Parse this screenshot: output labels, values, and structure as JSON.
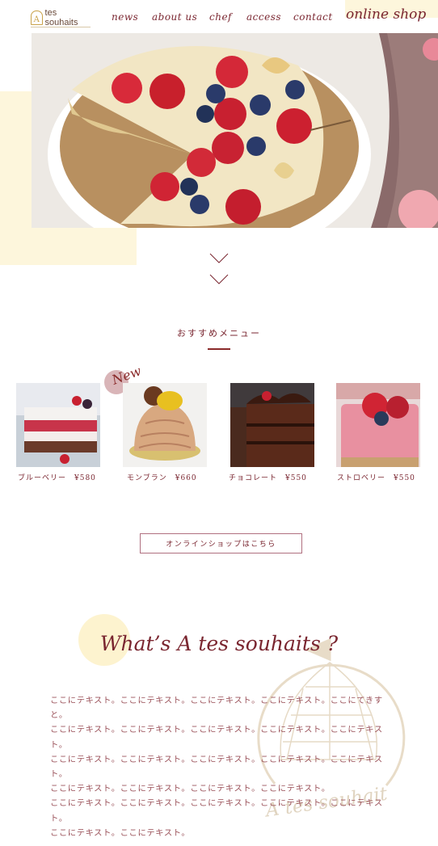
{
  "brand": {
    "logo_text": "tes souhaits",
    "logo_letter": "A"
  },
  "nav": {
    "news": "news",
    "about": "about us",
    "chef": "chef",
    "access": "access",
    "contact": "contact"
  },
  "online_shop": "online shop",
  "recommend": {
    "title": "おすすめメニュー",
    "new_badge": "New",
    "items": [
      {
        "name": "ブルーベリー　¥580"
      },
      {
        "name": "モンブラン　¥660"
      },
      {
        "name": "チョコレート　¥550"
      },
      {
        "name": "ストロベリー　¥550"
      }
    ],
    "shop_button": "オンラインショップはこちら"
  },
  "about": {
    "title": "What’s A tes souhaits ?",
    "lines": [
      "ここにテキスト。ここにテキスト。ここにテキスト。ここにテキスト。ここにてきすと。",
      "ここにテキスト。ここにテキスト。ここにテキスト。ここにテキスト。ここにテキスト。",
      "ここにテキスト。ここにテキスト。ここにテキスト。ここにテキスト。ここにテキスト。",
      "ここにテキスト。ここにテキスト。ここにテキスト。ここにテキスト。",
      "ここにテキスト。ここにテキスト。ここにテキスト。ここにテキスト。ここにテキスト。",
      "ここにテキスト。ここにテキスト。"
    ],
    "emblem_text": "A tes souhait"
  },
  "colors": {
    "accent": "#7a2630",
    "cream": "#fdf6dc",
    "line": "#8a2a2a"
  }
}
